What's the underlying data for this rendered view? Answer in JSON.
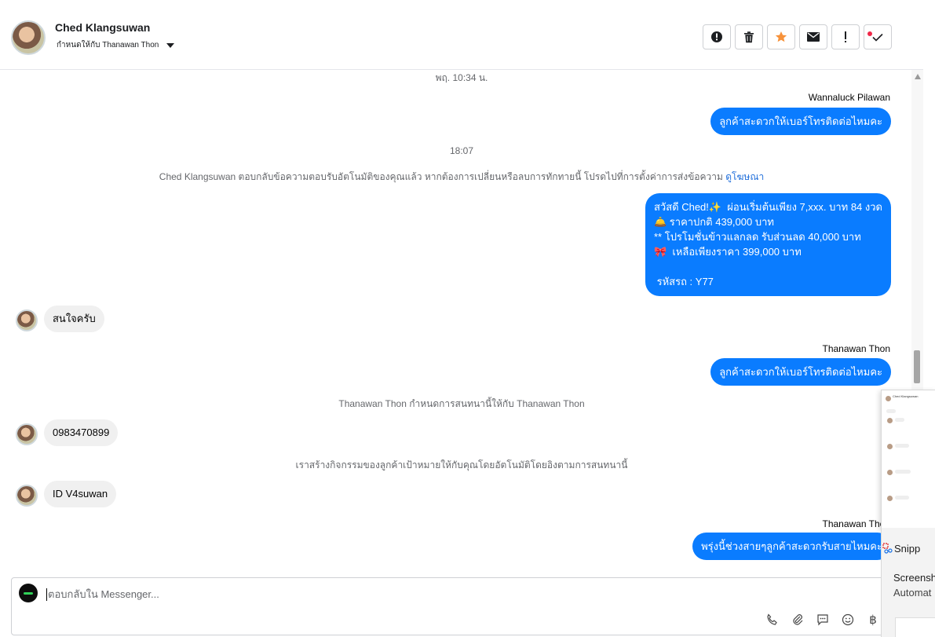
{
  "header": {
    "name": "Ched Klangsuwan",
    "assigned_text": "กำหนดให้กับ Thanawan Thon",
    "actions": [
      "spam-icon",
      "trash-icon",
      "star-icon",
      "mail-icon",
      "important-icon",
      "check-icon"
    ],
    "star_color": "#f7923a"
  },
  "messages": {
    "ts1": "พฤ. 10:34 น.",
    "sender1": "Wannaluck Pilawan",
    "out1": "ลูกค้าสะดวกให้เบอร์โทรติดต่อไหมคะ",
    "ts2": "18:07",
    "sys1": "Ched Klangsuwan ตอบกลับข้อความตอบรับอัตโนมัติของคุณแล้ว หากต้องการเปลี่ยนหรือลบการทักทายนี้ โปรดไปที่การตั้งค่าการส่งข้อความ",
    "sys1_link": "ดูโฆษณา",
    "promo": "สวัสดี Ched!✨  ผ่อนเริ่มต้นเพียง 7,xxx. บาท 84 งวด\n🛎️ ราคาปกติ 439,000 บาท\n** โปรโมชั่นข้าวแลกลด รับส่วนลด 40,000 บาท\n🎀  เหลือเพียงราคา 399,000 บาท\n\n รหัสรถ : Y77",
    "in1": "สนใจครับ",
    "sender2": "Thanawan Thon",
    "out2": "ลูกค้าสะดวกให้เบอร์โทรติดต่อไหมคะ",
    "sys2": "Thanawan Thon กำหนดการสนทนานี้ให้กับ Thanawan Thon",
    "in2": "0983470899",
    "sys3": "เราสร้างกิจกรรมของลูกค้าเป้าหมายให้กับคุณโดยอัตโนมัติโดยอิงตามการสนทนานี้",
    "in3": "ID V4suwan",
    "sender3": "Thanawan Thon",
    "out3": "พรุ่งนี้ช่วงสายๆลูกค้าสะดวกรับสายไหมคะ"
  },
  "composer": {
    "placeholder": "ตอบกลับใน Messenger...",
    "tools": [
      "phone-icon",
      "attach-icon",
      "saved-reply-icon",
      "emoji-icon",
      "baht-icon"
    ]
  },
  "overlay": {
    "mini_header": "Ched Klangsuwan",
    "snip_title": "Snipp",
    "snip_line1": "Screensh",
    "snip_line2": "Automat"
  },
  "colors": {
    "outgoing_bubble": "#0a7cff",
    "incoming_bubble": "#f0f0f0",
    "link": "#216fdb"
  }
}
